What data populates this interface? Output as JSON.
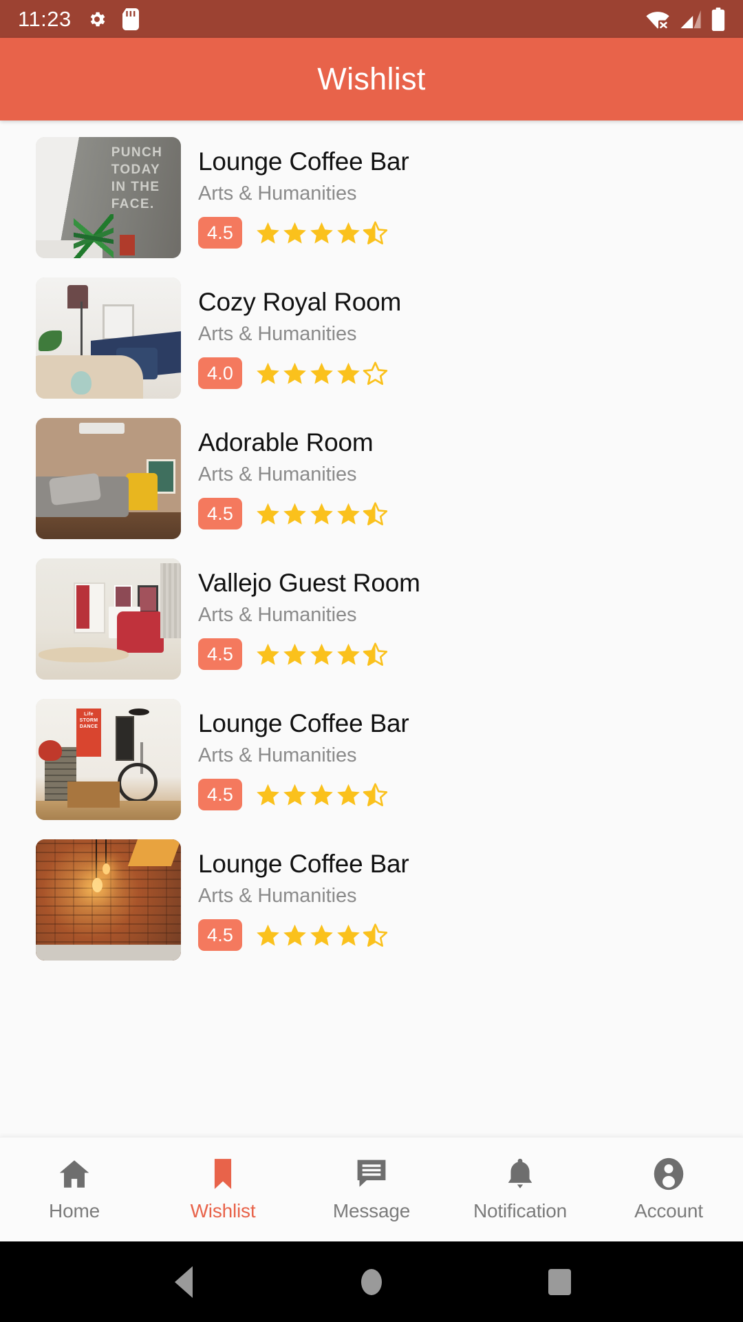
{
  "status_bar": {
    "time": "11:23",
    "icons": [
      "gear-icon",
      "sd-card-icon",
      "wifi-off-icon",
      "cellular-signal-icon",
      "battery-full-icon"
    ]
  },
  "app_bar": {
    "title": "Wishlist"
  },
  "theme": {
    "accent": "#e8634a",
    "badge": "#f4795e",
    "status_bar_bg": "#9c4232",
    "star": "#fac11c",
    "list_bg": "#fafafa"
  },
  "list": {
    "items": [
      {
        "title": "Lounge Coffee Bar",
        "category": "Arts & Humanities",
        "rating": "4.5",
        "stars_full": 4,
        "stars_half": 1,
        "thumb": "t1",
        "thumb_text": "PUNCH\nTODAY\nIN THE\nFACE."
      },
      {
        "title": "Cozy Royal Room",
        "category": "Arts & Humanities",
        "rating": "4.0",
        "stars_full": 4,
        "stars_half": 0,
        "thumb": "t2",
        "thumb_text": ""
      },
      {
        "title": "Adorable Room",
        "category": "Arts & Humanities",
        "rating": "4.5",
        "stars_full": 4,
        "stars_half": 1,
        "thumb": "t3",
        "thumb_text": ""
      },
      {
        "title": "Vallejo Guest Room",
        "category": "Arts & Humanities",
        "rating": "4.5",
        "stars_full": 4,
        "stars_half": 1,
        "thumb": "t4",
        "thumb_text": ""
      },
      {
        "title": "Lounge Coffee Bar",
        "category": "Arts & Humanities",
        "rating": "4.5",
        "stars_full": 4,
        "stars_half": 1,
        "thumb": "t5",
        "thumb_text": "Life\nSTORM\nDANCE"
      },
      {
        "title": "Lounge Coffee Bar",
        "category": "Arts & Humanities",
        "rating": "4.5",
        "stars_full": 4,
        "stars_half": 1,
        "thumb": "t6",
        "thumb_text": ""
      }
    ]
  },
  "bottom_nav": {
    "items": [
      {
        "label": "Home",
        "icon": "home-icon",
        "active": false
      },
      {
        "label": "Wishlist",
        "icon": "bookmark-icon",
        "active": true
      },
      {
        "label": "Message",
        "icon": "message-icon",
        "active": false
      },
      {
        "label": "Notification",
        "icon": "bell-icon",
        "active": false
      },
      {
        "label": "Account",
        "icon": "account-icon",
        "active": false
      }
    ]
  },
  "android_nav": {
    "back": "back-triangle-icon",
    "home": "home-circle-icon",
    "recents": "recents-square-icon"
  }
}
